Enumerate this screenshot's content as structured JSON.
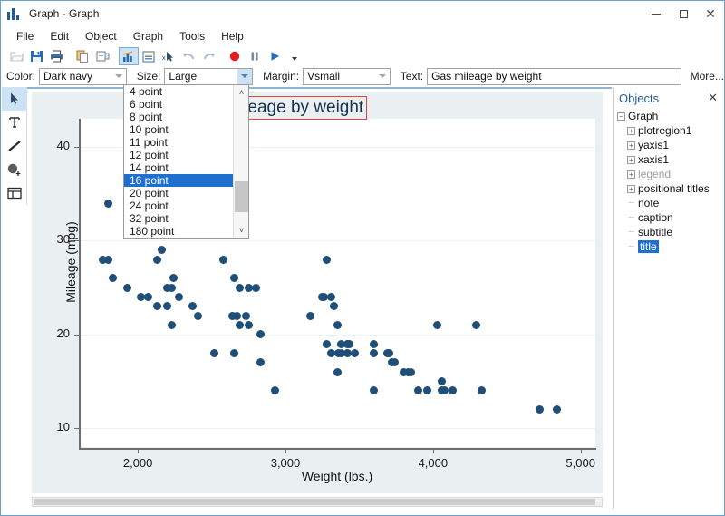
{
  "window": {
    "title": "Graph - Graph",
    "app_icon": "bar-chart-icon",
    "minimize": "–",
    "maximize": "□",
    "close": "✕"
  },
  "menu": {
    "items": [
      "File",
      "Edit",
      "Object",
      "Graph",
      "Tools",
      "Help"
    ]
  },
  "toolbar": {
    "buttons": [
      {
        "name": "open-icon",
        "glyph": "open"
      },
      {
        "name": "save-icon",
        "glyph": "save"
      },
      {
        "name": "print-icon",
        "glyph": "print"
      },
      {
        "name": "copy-icon",
        "glyph": "copy"
      },
      {
        "name": "paste-icon",
        "glyph": "paste"
      },
      {
        "name": "graph-editor-icon",
        "glyph": "chart"
      },
      {
        "name": "properties-icon",
        "glyph": "list"
      },
      {
        "name": "pointer-tool-icon",
        "glyph": "pointer"
      },
      {
        "name": "undo-icon",
        "glyph": "undo"
      },
      {
        "name": "redo-icon",
        "glyph": "redo"
      },
      {
        "name": "record-icon",
        "glyph": "record"
      },
      {
        "name": "pause-icon",
        "glyph": "pause"
      },
      {
        "name": "play-icon",
        "glyph": "play"
      },
      {
        "name": "overflow-icon",
        "glyph": "chevron"
      }
    ]
  },
  "formatbar": {
    "color_label": "Color:",
    "color_value": "Dark navy",
    "size_label": "Size:",
    "size_value": "Large",
    "margin_label": "Margin:",
    "margin_value": "Vsmall",
    "text_label": "Text:",
    "text_value": "Gas mileage by weight",
    "more_label": "More..."
  },
  "size_dropdown": {
    "open": true,
    "selected": "16 point",
    "options": [
      "4 point",
      "6 point",
      "8 point",
      "10 point",
      "11 point",
      "12 point",
      "14 point",
      "16 point",
      "20 point",
      "24 point",
      "32 point",
      "180 point"
    ],
    "scroll_up": "˄",
    "scroll_down": "˅"
  },
  "palette": {
    "tools": [
      {
        "name": "select-tool-icon",
        "glyph": "pointer",
        "selected": true
      },
      {
        "name": "text-tool-icon",
        "glyph": "text",
        "selected": false
      },
      {
        "name": "line-tool-icon",
        "glyph": "line",
        "selected": false
      },
      {
        "name": "marker-tool-icon",
        "glyph": "marker",
        "selected": false
      },
      {
        "name": "grid-tool-icon",
        "glyph": "grid",
        "selected": false
      }
    ]
  },
  "objects_panel": {
    "title": "Objects",
    "close": "✕",
    "tree": [
      {
        "label": "Graph",
        "depth": 0,
        "expander": "minus",
        "state": "normal"
      },
      {
        "label": "plotregion1",
        "depth": 1,
        "expander": "plus",
        "state": "normal"
      },
      {
        "label": "yaxis1",
        "depth": 1,
        "expander": "plus",
        "state": "normal"
      },
      {
        "label": "xaxis1",
        "depth": 1,
        "expander": "plus",
        "state": "normal"
      },
      {
        "label": "legend",
        "depth": 1,
        "expander": "plus",
        "state": "dimmed"
      },
      {
        "label": "positional titles",
        "depth": 1,
        "expander": "plus",
        "state": "normal"
      },
      {
        "label": "note",
        "depth": 1,
        "expander": "leaf",
        "state": "normal"
      },
      {
        "label": "caption",
        "depth": 1,
        "expander": "leaf",
        "state": "normal"
      },
      {
        "label": "subtitle",
        "depth": 1,
        "expander": "leaf",
        "state": "normal"
      },
      {
        "label": "title",
        "depth": 1,
        "expander": "leaf",
        "state": "selected"
      }
    ]
  },
  "colors": {
    "marker": "#1f4e79",
    "selection_border": "#e8433a",
    "highlight": "#1f6fd0",
    "graph_bg": "#eaf0f2",
    "plot_bg": "#ffffff",
    "accent": "#1f5c99"
  },
  "chart_data": {
    "type": "scatter",
    "title": "Gas mileage by weight",
    "xlabel": "Weight (lbs.)",
    "ylabel": "Mileage (mpg)",
    "xlim": [
      1600,
      5100
    ],
    "ylim": [
      8,
      43
    ],
    "xticks": [
      2000,
      3000,
      4000,
      5000
    ],
    "xticklabels": [
      "2,000",
      "3,000",
      "4,000",
      "5,000"
    ],
    "yticks": [
      10,
      20,
      30,
      40
    ],
    "yticklabels": [
      "10",
      "20",
      "30",
      "40"
    ],
    "grid": "horizontal",
    "legend": null,
    "marker_color": "#1f4e79",
    "marker_size": "large",
    "points": [
      [
        1800,
        34
      ],
      [
        1760,
        28
      ],
      [
        1800,
        28
      ],
      [
        1830,
        26
      ],
      [
        1930,
        25
      ],
      [
        2020,
        24
      ],
      [
        2070,
        24
      ],
      [
        2230,
        35
      ],
      [
        2200,
        31
      ],
      [
        2160,
        29
      ],
      [
        2130,
        28
      ],
      [
        2240,
        26
      ],
      [
        2200,
        25
      ],
      [
        2230,
        25
      ],
      [
        2280,
        24
      ],
      [
        2370,
        23
      ],
      [
        2130,
        23
      ],
      [
        2200,
        23
      ],
      [
        2230,
        21
      ],
      [
        2410,
        22
      ],
      [
        2580,
        28
      ],
      [
        2650,
        26
      ],
      [
        2690,
        25
      ],
      [
        2750,
        25
      ],
      [
        2800,
        25
      ],
      [
        2640,
        22
      ],
      [
        2670,
        22
      ],
      [
        2730,
        22
      ],
      [
        2690,
        21
      ],
      [
        2750,
        21
      ],
      [
        2830,
        20
      ],
      [
        2520,
        18
      ],
      [
        2650,
        18
      ],
      [
        2830,
        17
      ],
      [
        3170,
        22
      ],
      [
        3280,
        28
      ],
      [
        3250,
        24
      ],
      [
        3260,
        24
      ],
      [
        3310,
        24
      ],
      [
        3330,
        23
      ],
      [
        3350,
        21
      ],
      [
        3380,
        19
      ],
      [
        3420,
        19
      ],
      [
        3430,
        19
      ],
      [
        3280,
        19
      ],
      [
        3310,
        18
      ],
      [
        3360,
        18
      ],
      [
        3380,
        18
      ],
      [
        3420,
        18
      ],
      [
        3470,
        18
      ],
      [
        3600,
        19
      ],
      [
        3600,
        18
      ],
      [
        3690,
        18
      ],
      [
        3700,
        18
      ],
      [
        3720,
        17
      ],
      [
        3740,
        17
      ],
      [
        3800,
        16
      ],
      [
        3830,
        16
      ],
      [
        3850,
        16
      ],
      [
        4030,
        21
      ],
      [
        4060,
        14
      ],
      [
        4080,
        14
      ],
      [
        4130,
        14
      ],
      [
        4290,
        21
      ],
      [
        4330,
        14
      ],
      [
        3900,
        14
      ],
      [
        3960,
        14
      ],
      [
        4060,
        15
      ],
      [
        4720,
        12
      ],
      [
        4840,
        12
      ],
      [
        3350,
        16
      ],
      [
        3600,
        14
      ],
      [
        2930,
        14
      ]
    ]
  }
}
